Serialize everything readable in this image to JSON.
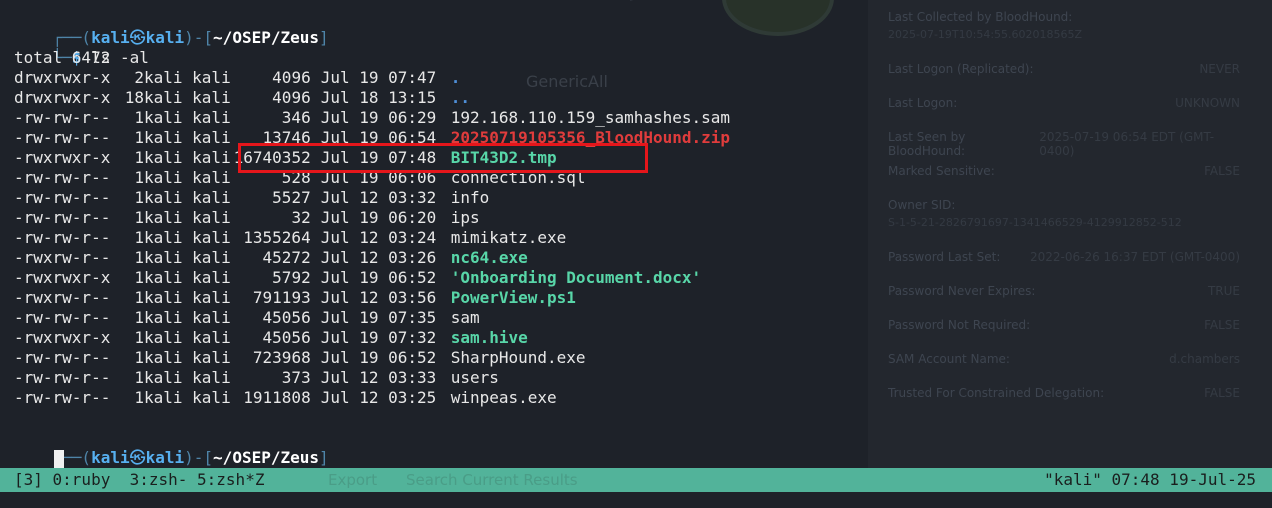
{
  "background_app": {
    "generic_label": "GenericAll",
    "fields": [
      {
        "label": "Last Collected by BloodHound:",
        "value": ""
      },
      {
        "label": "Last Logon (Replicated):",
        "value": "NEVER"
      },
      {
        "label": "Last Logon:",
        "value": "UNKNOWN"
      },
      {
        "label": "Last Seen by BloodHound:",
        "value": "2025-07-19 06:54 EDT (GMT-0400)"
      },
      {
        "label": "Marked Sensitive:",
        "value": "FALSE"
      },
      {
        "label": "Owner SID:",
        "value": ""
      },
      {
        "label": "Password Last Set:",
        "value": "2022-06-26 16:37 EDT (GMT-0400)"
      },
      {
        "label": "Password Never Expires:",
        "value": "TRUE"
      },
      {
        "label": "Password Not Required:",
        "value": "FALSE"
      },
      {
        "label": "SAM Account Name:",
        "value": "d.chambers"
      },
      {
        "label": "Trusted For Constrained Delegation:",
        "value": "FALSE"
      }
    ],
    "collected_value": "2025-07-19T10:54:55.602018565Z",
    "owner_sid_value": "S-1-5-21-2826791697-1341466529-4129912852-512",
    "footer_items": [
      "Export",
      "Search Current Results"
    ]
  },
  "prompt": {
    "frame_open": "┌──(",
    "user": "kali",
    "at": "㉿",
    "host": "kali",
    "frame_mid": ")-[",
    "dir": "~/OSEP/Zeus",
    "frame_close": "]",
    "frame_bottom": "└─",
    "dollar": "$"
  },
  "command": "ls -al",
  "total_line": "total 6472",
  "listing": [
    {
      "perm": "drwxrwxr-x",
      "links": "2",
      "owner": "kali kali",
      "size": "4096",
      "date": "Jul 19 07:47",
      "name": "."
    },
    {
      "perm": "drwxrwxr-x",
      "links": "18",
      "owner": "kali kali",
      "size": "4096",
      "date": "Jul 18 13:15",
      "name": ".."
    },
    {
      "perm": "-rw-rw-r--",
      "links": "1",
      "owner": "kali kali",
      "size": "346",
      "date": "Jul 19 06:29",
      "name": "192.168.110.159_samhashes.sam"
    },
    {
      "perm": "-rw-rw-r--",
      "links": "1",
      "owner": "kali kali",
      "size": "13746",
      "date": "Jul 19 06:54",
      "name": "20250719105356_BloodHound.zip"
    },
    {
      "perm": "-rwxrwxr-x",
      "links": "1",
      "owner": "kali kali",
      "size": "16740352",
      "date": "Jul 19 07:48",
      "name": "BIT43D2.tmp"
    },
    {
      "perm": "-rw-rw-r--",
      "links": "1",
      "owner": "kali kali",
      "size": "528",
      "date": "Jul 19 06:06",
      "name": "connection.sql"
    },
    {
      "perm": "-rw-rw-r--",
      "links": "1",
      "owner": "kali kali",
      "size": "5527",
      "date": "Jul 12 03:32",
      "name": "info"
    },
    {
      "perm": "-rw-rw-r--",
      "links": "1",
      "owner": "kali kali",
      "size": "32",
      "date": "Jul 19 06:20",
      "name": "ips"
    },
    {
      "perm": "-rw-rw-r--",
      "links": "1",
      "owner": "kali kali",
      "size": "1355264",
      "date": "Jul 12 03:24",
      "name": "mimikatz.exe"
    },
    {
      "perm": "-rwxrw-r--",
      "links": "1",
      "owner": "kali kali",
      "size": "45272",
      "date": "Jul 12 03:26",
      "name": "nc64.exe"
    },
    {
      "perm": "-rwxrwxr-x",
      "links": "1",
      "owner": "kali kali",
      "size": "5792",
      "date": "Jul 19 06:52",
      "name": "'Onboarding Document.docx'"
    },
    {
      "perm": "-rwxrw-r--",
      "links": "1",
      "owner": "kali kali",
      "size": "791193",
      "date": "Jul 12 03:56",
      "name": "PowerView.ps1"
    },
    {
      "perm": "-rw-rw-r--",
      "links": "1",
      "owner": "kali kali",
      "size": "45056",
      "date": "Jul 19 07:35",
      "name": "sam"
    },
    {
      "perm": "-rwxrwxr-x",
      "links": "1",
      "owner": "kali kali",
      "size": "45056",
      "date": "Jul 19 07:32",
      "name": "sam.hive"
    },
    {
      "perm": "-rw-rw-r--",
      "links": "1",
      "owner": "kali kali",
      "size": "723968",
      "date": "Jul 19 06:52",
      "name": "SharpHound.exe"
    },
    {
      "perm": "-rw-rw-r--",
      "links": "1",
      "owner": "kali kali",
      "size": "373",
      "date": "Jul 12 03:33",
      "name": "users"
    },
    {
      "perm": "-rw-rw-r--",
      "links": "1",
      "owner": "kali kali",
      "size": "1911808",
      "date": "Jul 12 03:25",
      "name": "winpeas.exe"
    }
  ],
  "statusbar": {
    "left": "[3] 0:ruby  3:zsh- 5:zsh*Z",
    "right": "\"kali\" 07:48 19-Jul-25"
  },
  "colors": {
    "dir": "#4f8fd8",
    "archive": "#e03c3c",
    "executable": "#58d6a8",
    "highlight": "#e5161b",
    "statusbar": "#52b39a"
  }
}
